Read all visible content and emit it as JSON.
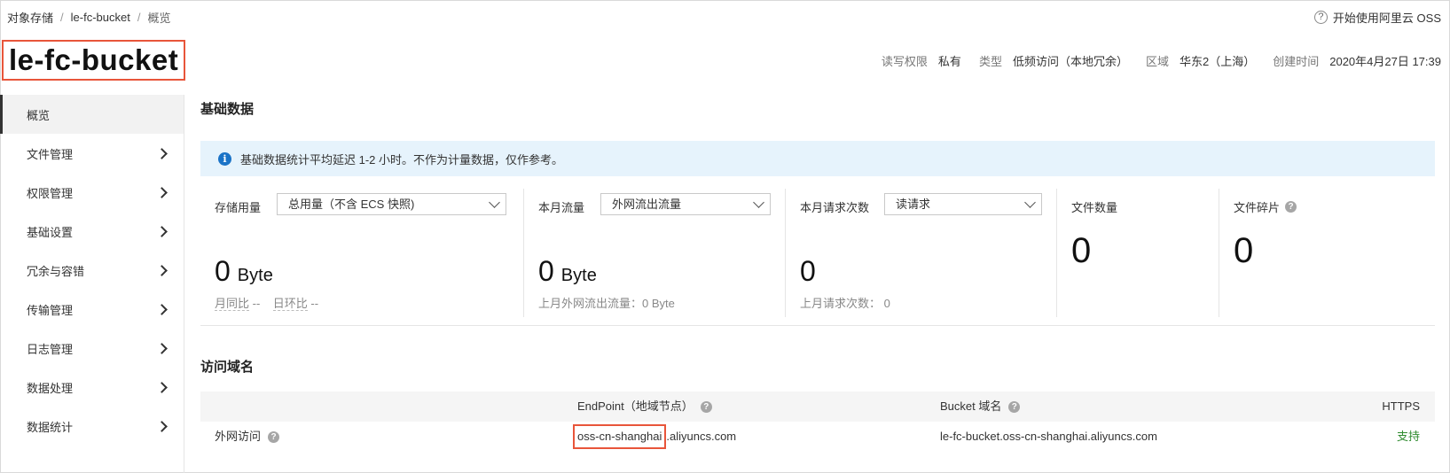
{
  "breadcrumb": [
    "对象存储",
    "le-fc-bucket",
    "概览"
  ],
  "breadcrumb_sep": "/",
  "help_link": "开始使用阿里云 OSS",
  "bucket_name": "le-fc-bucket",
  "meta": [
    {
      "key": "读写权限",
      "value": "私有"
    },
    {
      "key": "类型",
      "value": "低频访问（本地冗余）"
    },
    {
      "key": "区域",
      "value": "华东2（上海）"
    },
    {
      "key": "创建时间",
      "value": "2020年4月27日 17:39"
    }
  ],
  "sidebar": [
    {
      "label": "概览",
      "active": true
    },
    {
      "label": "文件管理"
    },
    {
      "label": "权限管理"
    },
    {
      "label": "基础设置"
    },
    {
      "label": "冗余与容错"
    },
    {
      "label": "传输管理"
    },
    {
      "label": "日志管理"
    },
    {
      "label": "数据处理"
    },
    {
      "label": "数据统计"
    }
  ],
  "basic_title": "基础数据",
  "notice": "基础数据统计平均延迟 1-2 小时。不作为计量数据，仅作参考。",
  "stats": {
    "storage": {
      "label": "存储用量",
      "select": "总用量（不含 ECS 快照)",
      "value": "0",
      "unit": "Byte",
      "mom_label": "月同比",
      "mom_value": "--",
      "dod_label": "日环比",
      "dod_value": "--"
    },
    "traffic": {
      "label": "本月流量",
      "select": "外网流出流量",
      "value": "0",
      "unit": "Byte",
      "sub": "上月外网流出流量：0 Byte"
    },
    "requests": {
      "label": "本月请求次数",
      "select": "读请求",
      "value": "0",
      "sub": "上月请求次数：  0"
    },
    "files": {
      "label": "文件数量",
      "value": "0"
    },
    "fragments": {
      "label": "文件碎片",
      "value": "0"
    }
  },
  "domain_title": "访问域名",
  "table": {
    "headers": {
      "endpoint": "EndPoint（地域节点）",
      "bucket_domain": "Bucket 域名",
      "https": "HTTPS"
    },
    "rows": [
      {
        "type": "外网访问",
        "endpoint_highlight": "oss-cn-shanghai",
        "endpoint_rest": ".aliyuncs.com",
        "bucket_domain": "le-fc-bucket.oss-cn-shanghai.aliyuncs.com",
        "https": "支持"
      }
    ]
  },
  "colors": {
    "highlight": "#e8553a",
    "notice_bg": "#e6f3fc",
    "info_blue": "#1a73c7",
    "support_green": "#2e8b2e"
  }
}
